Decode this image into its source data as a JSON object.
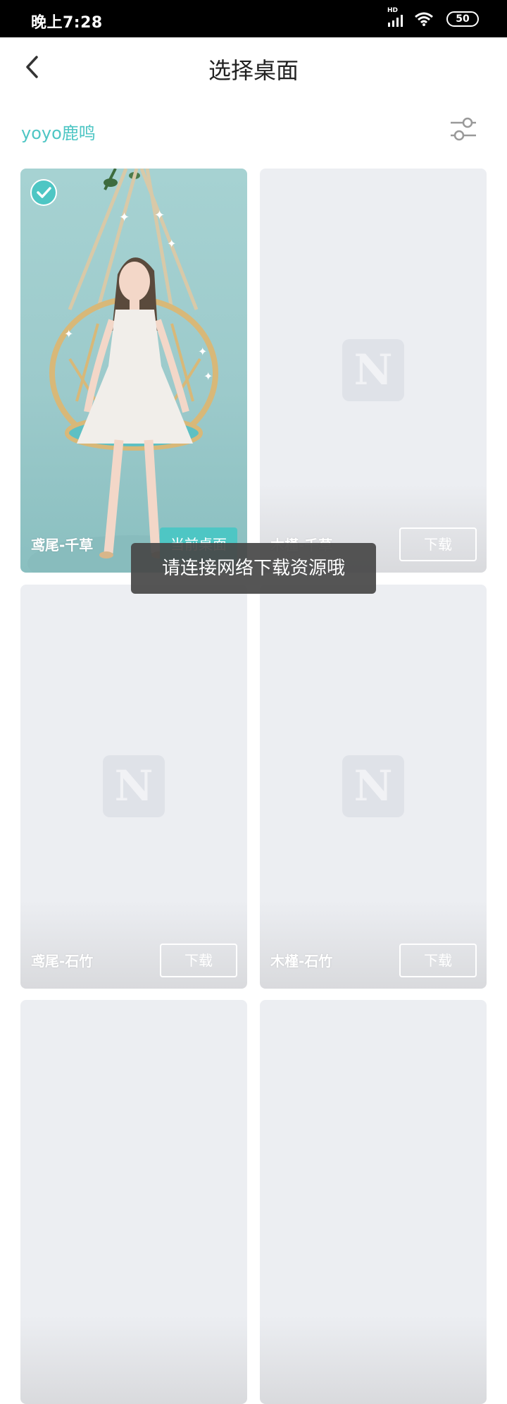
{
  "status_bar": {
    "time": "晚上7:28",
    "network": "HD",
    "battery": "50"
  },
  "header": {
    "title": "选择桌面",
    "back_icon": "chevron-left-icon"
  },
  "account": {
    "name": "yoyo鹿鸣",
    "filter_icon": "sliders-icon"
  },
  "cards": [
    {
      "name": "鸢尾-千草",
      "action": "当前桌面",
      "selected": true
    },
    {
      "name": "木槿-千草",
      "action": "下载",
      "placeholder": "N"
    },
    {
      "name": "鸢尾-石竹",
      "action": "下载",
      "placeholder": "N"
    },
    {
      "name": "木槿-石竹",
      "action": "下载",
      "placeholder": "N"
    },
    {
      "name": "",
      "action": ""
    },
    {
      "name": "",
      "action": ""
    }
  ],
  "toast": {
    "message": "请连接网络下载资源哦"
  },
  "colors": {
    "accent": "#4ec6c4",
    "placeholder_bg": "#eceef2",
    "toast_bg": "#464646"
  }
}
